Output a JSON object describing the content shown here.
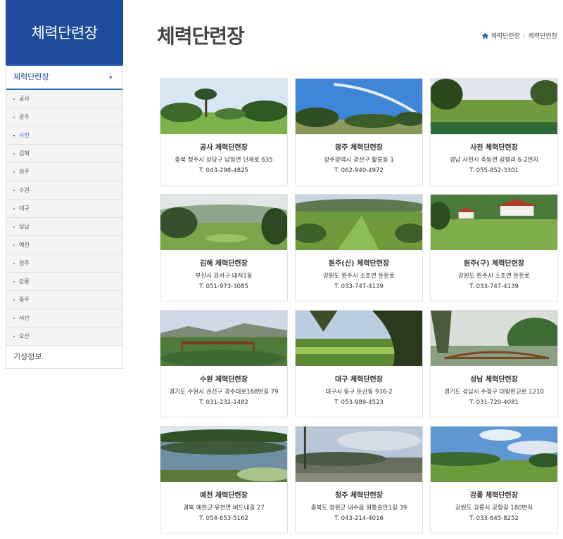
{
  "sidebar": {
    "title": "체력단련장",
    "active_label": "체력단련장",
    "active_arrow": "▸",
    "items": [
      "공사",
      "광주",
      "사천",
      "김해",
      "원주",
      "수원",
      "대구",
      "성남",
      "예천",
      "청주",
      "강릉",
      "중주",
      "서산",
      "오산"
    ],
    "active_index": 2,
    "extra_label": "기상정보",
    "accent_color": "#1e4c9c"
  },
  "header": {
    "title": "체력단련장",
    "breadcrumb": [
      "체력단련장",
      "체력단련장"
    ],
    "home_icon": "home-icon",
    "separator": "›"
  },
  "cards": [
    {
      "title": "공사 체력단련장",
      "address": "충북 청주시 상당구 남일면 단재로 635",
      "tel": "T. 043-298-4825"
    },
    {
      "title": "광주 체력단련장",
      "address": "광주광역시 광산구 활룡동 1",
      "tel": "T. 062-940-4972"
    },
    {
      "title": "사천 체력단련장",
      "address": "경남 사천시 축동면 길평리 6-2번지",
      "tel": "T. 055-852-3301"
    },
    {
      "title": "김해 체력단련장",
      "address": "부산시 강서구 대저1동",
      "tel": "T. 051-973-3085"
    },
    {
      "title": "원주(신) 체력단련장",
      "address": "강원도 원주시 소초면 둔둔로",
      "tel": "T. 033-747-4139"
    },
    {
      "title": "원주(구) 체력단련장",
      "address": "강원도 원주시 소초면 둔둔로",
      "tel": "T. 033-747-4139"
    },
    {
      "title": "수원 체력단련장",
      "address": "경기도 수원시 권선구 경수대로168번길 79",
      "tel": "T. 031-232-1482"
    },
    {
      "title": "대구 체력단련장",
      "address": "대구시 동구 둔산동 936-2",
      "tel": "T. 053-989-4523"
    },
    {
      "title": "성남 체력단련장",
      "address": "경기도 성남시 수정구 대왕판교로 1210",
      "tel": "T. 031-720-4081"
    },
    {
      "title": "예천 체력단련장",
      "address": "경북 예천군 유천면 버드내길 27",
      "tel": "T. 054-653-5162"
    },
    {
      "title": "청주 체력단련장",
      "address": "충북도 청원군 내수읍 원통술안1길 39",
      "tel": "T. 043-214-4016"
    },
    {
      "title": "강릉 체력단련장",
      "address": "강원도 강릉시 공항길 180번지",
      "tel": "T. 033-645-8252"
    }
  ]
}
